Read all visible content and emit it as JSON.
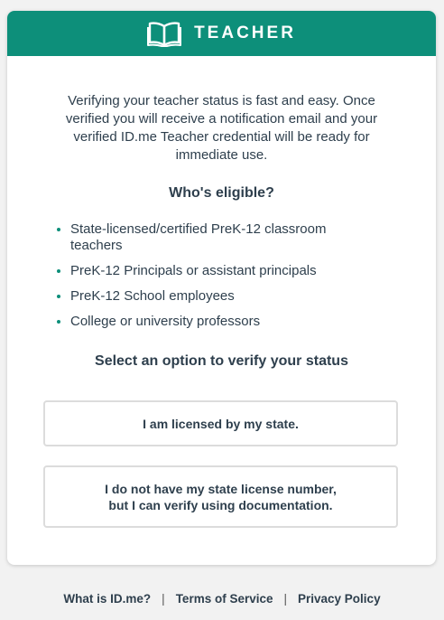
{
  "header": {
    "title": "TEACHER"
  },
  "intro_text": "Verifying your teacher status is fast and easy. Once verified you will receive a notification email and your verified ID.me Teacher credential will be ready for immediate use.",
  "eligible": {
    "heading": "Who's eligible?",
    "items": [
      "State-licensed/certified PreK-12 classroom teachers",
      "PreK-12 Principals or assistant principals",
      "PreK-12 School employees",
      "College or university professors"
    ]
  },
  "select_heading": "Select an option to verify your status",
  "options": {
    "licensed_label": "I am licensed by my state.",
    "documentation_line1": "I do not have my state license number,",
    "documentation_line2": "but I can verify using documentation."
  },
  "footer": {
    "what_is": "What is ID.me?",
    "terms": "Terms of Service",
    "privacy": "Privacy Policy",
    "separator": "|"
  },
  "colors": {
    "brand": "#0d8f7a",
    "text": "#2e3f4d"
  },
  "icons": {
    "header": "open-book-icon"
  }
}
